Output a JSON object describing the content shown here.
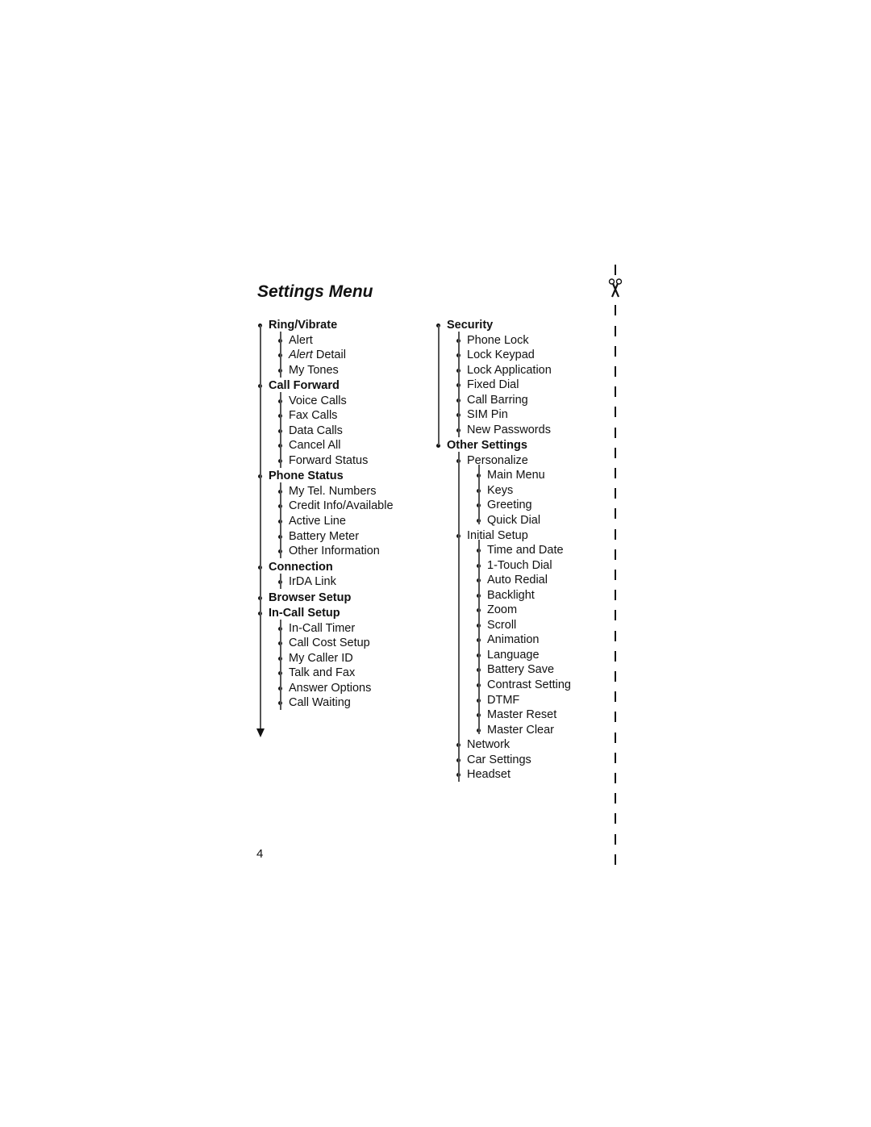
{
  "page": {
    "title": "Settings Menu",
    "page_number": "4",
    "cut_mark_icon": "scissors-icon"
  },
  "left_column": [
    {
      "label": "Ring/Vibrate",
      "children": [
        {
          "label": "Alert"
        },
        {
          "label_italic": "Alert",
          "label_rest": " Detail"
        },
        {
          "label": "My Tones"
        }
      ]
    },
    {
      "label": "Call Forward",
      "children": [
        {
          "label": "Voice Calls"
        },
        {
          "label": "Fax Calls"
        },
        {
          "label": "Data Calls"
        },
        {
          "label": "Cancel All"
        },
        {
          "label": "Forward Status"
        }
      ]
    },
    {
      "label": "Phone Status",
      "children": [
        {
          "label": "My Tel. Numbers"
        },
        {
          "label": "Credit Info/Available"
        },
        {
          "label": "Active Line"
        },
        {
          "label": "Battery Meter"
        },
        {
          "label": "Other Information"
        }
      ]
    },
    {
      "label": "Connection",
      "children": [
        {
          "label": "IrDA Link"
        }
      ]
    },
    {
      "label": "Browser Setup",
      "children": []
    },
    {
      "label": "In-Call Setup",
      "children": [
        {
          "label": "In-Call Timer"
        },
        {
          "label": "Call Cost Setup"
        },
        {
          "label": "My Caller ID"
        },
        {
          "label": "Talk and Fax"
        },
        {
          "label": "Answer Options"
        },
        {
          "label": "Call Waiting"
        }
      ]
    }
  ],
  "right_column": [
    {
      "label": "Security",
      "children": [
        {
          "label": "Phone Lock"
        },
        {
          "label": "Lock Keypad"
        },
        {
          "label": "Lock Application"
        },
        {
          "label": "Fixed Dial"
        },
        {
          "label": "Call Barring"
        },
        {
          "label": "SIM Pin"
        },
        {
          "label": "New Passwords"
        }
      ]
    },
    {
      "label": "Other Settings",
      "children": [
        {
          "label": "Personalize",
          "children": [
            {
              "label": "Main Menu"
            },
            {
              "label": "Keys"
            },
            {
              "label": "Greeting"
            },
            {
              "label": "Quick Dial"
            }
          ]
        },
        {
          "label": "Initial Setup",
          "children": [
            {
              "label": "Time and Date"
            },
            {
              "label": "1-Touch Dial"
            },
            {
              "label": "Auto Redial"
            },
            {
              "label": "Backlight"
            },
            {
              "label": "Zoom"
            },
            {
              "label": "Scroll"
            },
            {
              "label": "Animation"
            },
            {
              "label": "Language"
            },
            {
              "label": "Battery Save"
            },
            {
              "label": "Contrast Setting"
            },
            {
              "label": "DTMF"
            },
            {
              "label": "Master Reset"
            },
            {
              "label": "Master Clear"
            }
          ]
        },
        {
          "label": "Network"
        },
        {
          "label": "Car Settings"
        },
        {
          "label": "Headset"
        }
      ]
    }
  ]
}
